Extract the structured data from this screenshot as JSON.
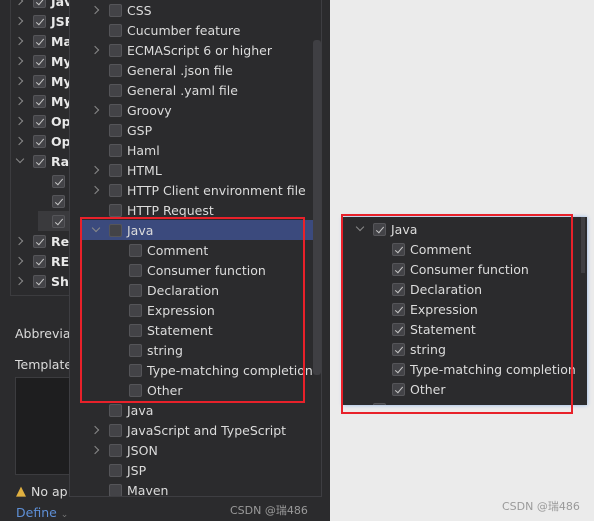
{
  "background_tree": [
    {
      "label": "Jav",
      "checked": true,
      "expanded": false
    },
    {
      "label": "JSP",
      "checked": true,
      "expanded": false
    },
    {
      "label": "Ma",
      "checked": true,
      "expanded": false
    },
    {
      "label": "My",
      "checked": true,
      "expanded": false
    },
    {
      "label": "My",
      "checked": true,
      "expanded": false
    },
    {
      "label": "My",
      "checked": true,
      "expanded": false
    },
    {
      "label": "Op",
      "checked": true,
      "expanded": false
    },
    {
      "label": "Op",
      "checked": true,
      "expanded": false
    },
    {
      "label": "Ray",
      "checked": true,
      "expanded": true
    },
    {
      "label": "",
      "checked": true,
      "child": true
    },
    {
      "label": "",
      "checked": true,
      "child": true
    },
    {
      "label": "",
      "checked": true,
      "child": true,
      "selected": true
    },
    {
      "label": "Rea",
      "checked": true,
      "expanded": false
    },
    {
      "label": "RES",
      "checked": true,
      "expanded": false
    },
    {
      "label": "Sho",
      "checked": true,
      "expanded": false
    }
  ],
  "form": {
    "abbreviation_label": "Abbreviat",
    "template_label": "Template",
    "warning_text": "No ap",
    "define_link": "Define"
  },
  "popup": {
    "items": [
      {
        "label": "CSS",
        "chevron": true
      },
      {
        "label": "Cucumber feature",
        "chevron": false
      },
      {
        "label": "ECMAScript 6 or higher",
        "chevron": true
      },
      {
        "label": "General .json file",
        "chevron": false
      },
      {
        "label": "General .yaml file",
        "chevron": false
      },
      {
        "label": "Groovy",
        "chevron": true
      },
      {
        "label": "GSP",
        "chevron": false
      },
      {
        "label": "Haml",
        "chevron": false
      },
      {
        "label": "HTML",
        "chevron": true
      },
      {
        "label": "HTTP Client environment file",
        "chevron": true
      },
      {
        "label": "HTTP Request",
        "chevron": false
      }
    ],
    "java": {
      "label": "Java",
      "checked": false,
      "children": [
        "Comment",
        "Consumer function",
        "Declaration",
        "Expression",
        "Statement",
        "string",
        "Type-matching completion",
        "Other"
      ]
    },
    "after_items": [
      {
        "label": "Java",
        "chevron": false
      },
      {
        "label": "JavaScript and TypeScript",
        "chevron": true
      },
      {
        "label": "JSON",
        "chevron": true
      },
      {
        "label": "JSP",
        "chevron": false
      },
      {
        "label": "Maven",
        "chevron": false
      }
    ]
  },
  "right_popup": {
    "java": {
      "label": "Java",
      "checked": true,
      "children": [
        "Comment",
        "Consumer function",
        "Declaration",
        "Expression",
        "Statement",
        "string",
        "Type-matching completion",
        "Other"
      ]
    }
  },
  "watermark": "CSDN @瑞486",
  "colors": {
    "highlight": "#e8212a",
    "selection": "#3b4a7d",
    "panel": "#2b2b2d"
  }
}
